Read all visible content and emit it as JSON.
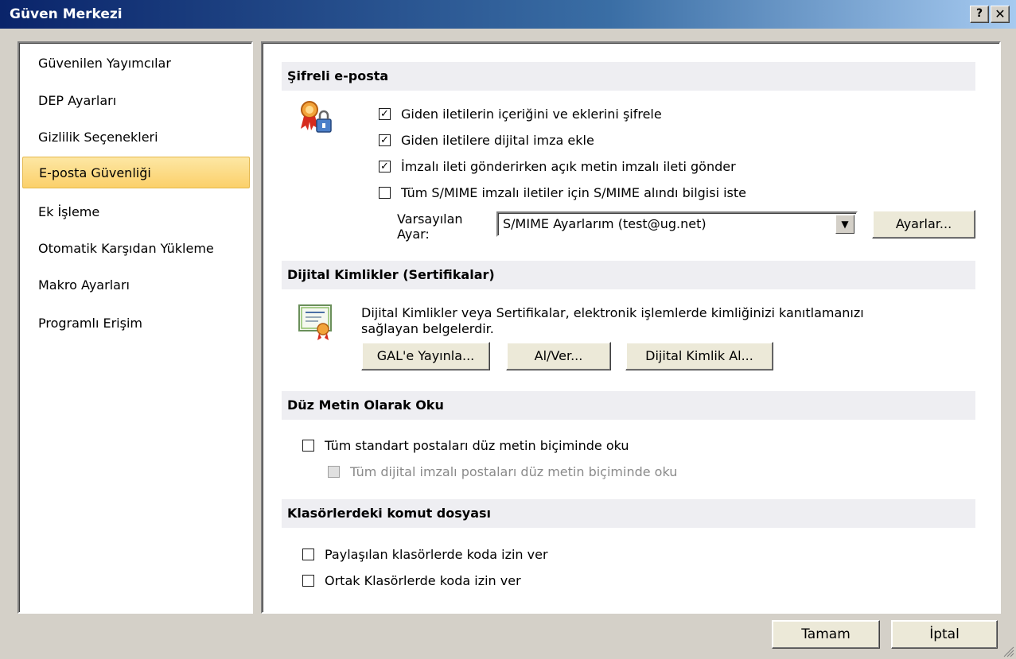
{
  "window": {
    "title": "Güven Merkezi",
    "help_glyph": "?",
    "close_glyph": "✕"
  },
  "sidebar": {
    "items": [
      {
        "label": "Güvenilen Yayımcılar",
        "active": false
      },
      {
        "label": "DEP Ayarları",
        "active": false
      },
      {
        "label": "Gizlilik Seçenekleri",
        "active": false
      },
      {
        "label": "E-posta Güvenliği",
        "active": true
      },
      {
        "label": "Ek İşleme",
        "active": false
      },
      {
        "label": "Otomatik Karşıdan Yükleme",
        "active": false
      },
      {
        "label": "Makro Ayarları",
        "active": false
      },
      {
        "label": "Programlı Erişim",
        "active": false
      }
    ]
  },
  "encrypted_email": {
    "header": "Şifreli e-posta",
    "options": [
      {
        "label": "Giden iletilerin içeriğini ve eklerini şifrele",
        "checked": true
      },
      {
        "label": "Giden iletilere dijital imza ekle",
        "checked": true
      },
      {
        "label": "İmzalı ileti gönderirken açık metin imzalı ileti gönder",
        "checked": true
      },
      {
        "label": "Tüm S/MIME imzalı iletiler için S/MIME alındı bilgisi iste",
        "checked": false
      }
    ],
    "default_setting_label_1": "Varsayılan",
    "default_setting_label_2": "Ayar:",
    "default_setting_value": "S/MIME Ayarlarım (test@ug.net)",
    "settings_button": "Ayarlar..."
  },
  "digital_ids": {
    "header": "Dijital Kimlikler (Sertifikalar)",
    "description_line1": "Dijital Kimlikler veya Sertifikalar, elektronik işlemlerde kimliğinizi kanıtlamanızı",
    "description_line2": "sağlayan belgelerdir.",
    "publish_button": "GAL'e Yayınla...",
    "import_export_button": "Al/Ver...",
    "get_id_button": "Dijital Kimlik Al..."
  },
  "plain_text": {
    "header": "Düz Metin Olarak Oku",
    "read_all_label": "Tüm standart postaları düz metin biçiminde oku",
    "read_all_checked": false,
    "read_signed_label": "Tüm dijital imzalı postaları düz metin biçiminde oku",
    "read_signed_checked": false,
    "read_signed_enabled": false
  },
  "folder_script": {
    "header": "Klasörlerdeki komut dosyası",
    "shared_label": "Paylaşılan klasörlerde koda izin ver",
    "shared_checked": false,
    "public_label": "Ortak Klasörlerde koda izin ver",
    "public_checked": false
  },
  "footer": {
    "ok_button": "Tamam",
    "cancel_button": "İptal"
  },
  "colors": {
    "titlebar_start": "#0a246a",
    "titlebar_end": "#a6caf0",
    "active_item": "#fbd06a",
    "section_header": "#eeeef2"
  },
  "icons": {
    "security_icon": "ribbon-lock-icon",
    "certificate_icon": "certificate-icon",
    "resize_grip": "resize-grip-icon"
  }
}
